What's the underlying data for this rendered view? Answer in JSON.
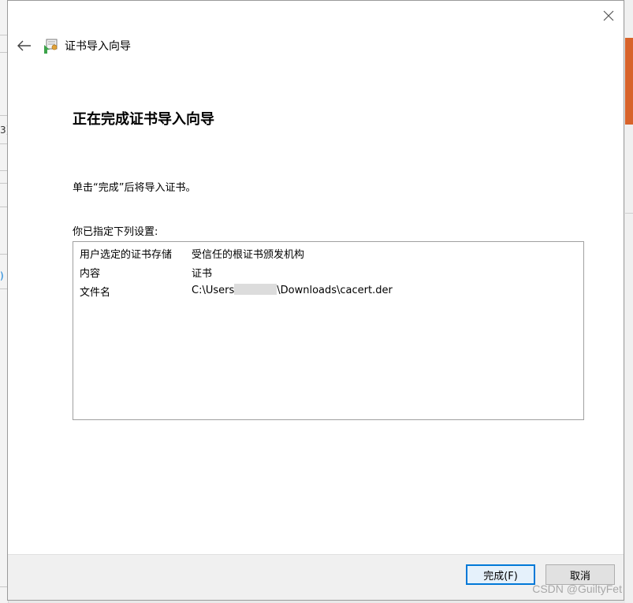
{
  "background": {
    "left_fragment_text": "3)",
    "left_fragment_text2": ")"
  },
  "dialog": {
    "close_glyph": "✕",
    "back_glyph": "←",
    "wizard_title": "证书导入向导",
    "heading": "正在完成证书导入向导",
    "instruction": "单击“完成”后将导入证书。",
    "settings_label": "你已指定下列设置:",
    "settings": [
      {
        "key": "用户选定的证书存储",
        "value": "受信任的根证书颁发机构"
      },
      {
        "key": "内容",
        "value": "证书"
      },
      {
        "key": "文件名",
        "value_prefix": "C:\\Users",
        "value_suffix": "\\Downloads\\cacert.der"
      }
    ],
    "buttons": {
      "finish": "完成(F)",
      "cancel": "取消"
    }
  },
  "watermark": "CSDN @GuiltyFet",
  "colors": {
    "accent": "#0078d7",
    "orange_bg": "#d8632a"
  },
  "icons": {
    "close": "close-icon",
    "back": "back-arrow-icon",
    "wizard": "certificate-wizard-icon"
  }
}
